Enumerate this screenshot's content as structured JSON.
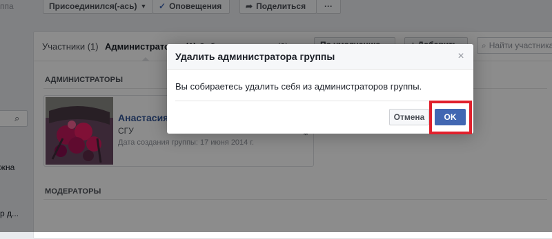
{
  "sidebar": {
    "fragment_top": "ппа",
    "fragment_mid": "жна",
    "fragment_low": "р д..."
  },
  "top_actions": {
    "joined_label": "Присоединился(-ась)",
    "notifications_label": "Оповещения",
    "share_label": "Поделиться",
    "more_label": "···"
  },
  "tabs": [
    {
      "label": "Участники (1)"
    },
    {
      "label": "Администраторы (1)"
    },
    {
      "label": "Заблокированные (0)"
    }
  ],
  "tab_controls": {
    "sort_label": "По умолчанию",
    "add_label": "+ Добавить",
    "search_placeholder": "Найти участника"
  },
  "sections": {
    "admins_title": "АДМИНИСТРАТОРЫ",
    "moderators_title": "МОДЕРАТОРЫ"
  },
  "admin": {
    "name": "Анастасия",
    "subtitle": "СГУ",
    "date": "Дата создания группы: 17 июня 2014 г."
  },
  "dialog": {
    "title": "Удалить администратора группы",
    "message": "Вы собираетесь удалить себя из администраторов группы.",
    "cancel_label": "Отмена",
    "ok_label": "OK",
    "close_symbol": "×"
  },
  "colors": {
    "primary_button": "#4267b2",
    "highlight": "#e0202c",
    "link": "#365899"
  }
}
